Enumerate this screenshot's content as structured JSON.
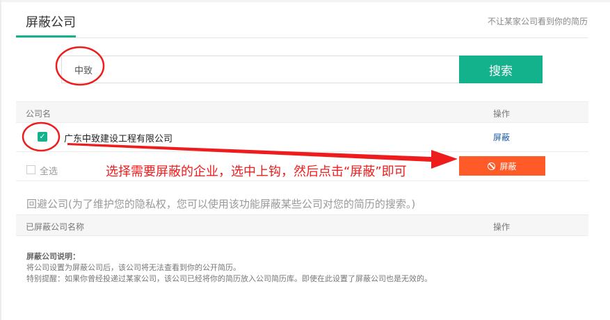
{
  "header": {
    "title": "屏蔽公司",
    "hint": "不让某家公司看到你的简历"
  },
  "search": {
    "value": "中致",
    "button_label": "搜索"
  },
  "results_table": {
    "col_company": "公司名",
    "col_action": "操作",
    "rows": [
      {
        "company": "广东中致建设工程有限公司",
        "action": "屏蔽",
        "checked": true
      }
    ]
  },
  "select_all": {
    "label": "全选",
    "block_button_label": "屏蔽"
  },
  "annotation": {
    "text": "选择需要屏蔽的企业，选中上钩，然后点击“屏蔽”即可",
    "color": "#ee1c1c"
  },
  "avoid_section": {
    "title": "回避公司(为了维护您的隐私权，您可以使用该功能屏蔽某些公司对您的简历的搜索。)"
  },
  "blocked_table": {
    "col_company": "已屏蔽公司名称",
    "col_action": "操作"
  },
  "notes": {
    "title": "屏蔽公司说明：",
    "line1": "将公司设置为屏蔽公司后，该公司将无法查看到你的公开简历。",
    "line2": "特别提醒：如果你曾经投递过某家公司，该公司已经将你的简历放入公司简历库。即使在此设置了屏蔽公司也是无效的。"
  },
  "colors": {
    "accent": "#13b28c",
    "danger": "#ff5b29",
    "link": "#1b5aa0"
  }
}
